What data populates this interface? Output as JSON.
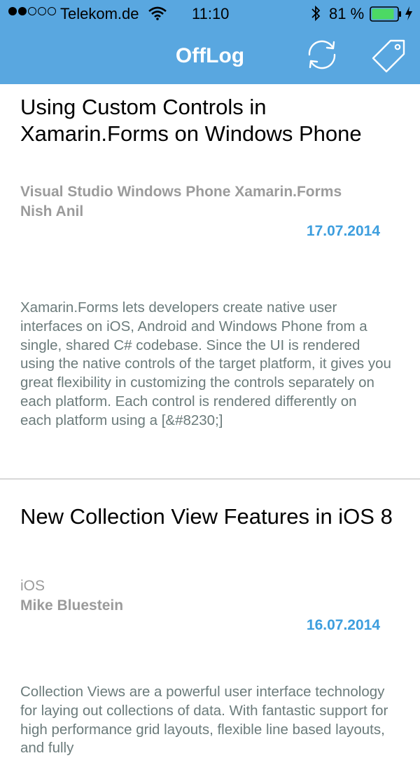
{
  "status_bar": {
    "carrier": "Telekom.de",
    "time": "11:10",
    "battery": "81 %",
    "signal_strength": "2 of 5"
  },
  "nav": {
    "title": "OffLog"
  },
  "articles": [
    {
      "title": "Using Custom Controls in Xamarin.Forms on Windows Phone",
      "tags": "Visual Studio Windows Phone Xamarin.Forms",
      "author": "Nish Anil",
      "date": "17.07.2014",
      "excerpt": "Xamarin.Forms lets developers create native user interfaces on iOS, Android and Windows Phone from a single, shared C# codebase. Since the UI is rendered using the native controls of the target platform, it gives you great flexibility in customizing the controls separately on each platform. Each control is rendered differently on each platform using a [&#8230;]"
    },
    {
      "title": "New Collection View Features in iOS 8",
      "tags": "iOS",
      "author": "Mike Bluestein",
      "date": "16.07.2014",
      "excerpt": "Collection Views are a powerful user interface technology for laying out collections of data. With fantastic support for high performance grid layouts, flexible line based layouts, and fully"
    }
  ],
  "colors": {
    "nav_background": "#59a7e0",
    "date": "#3d9ede",
    "meta": "#9b9b9b",
    "excerpt": "#6b7b7b"
  }
}
